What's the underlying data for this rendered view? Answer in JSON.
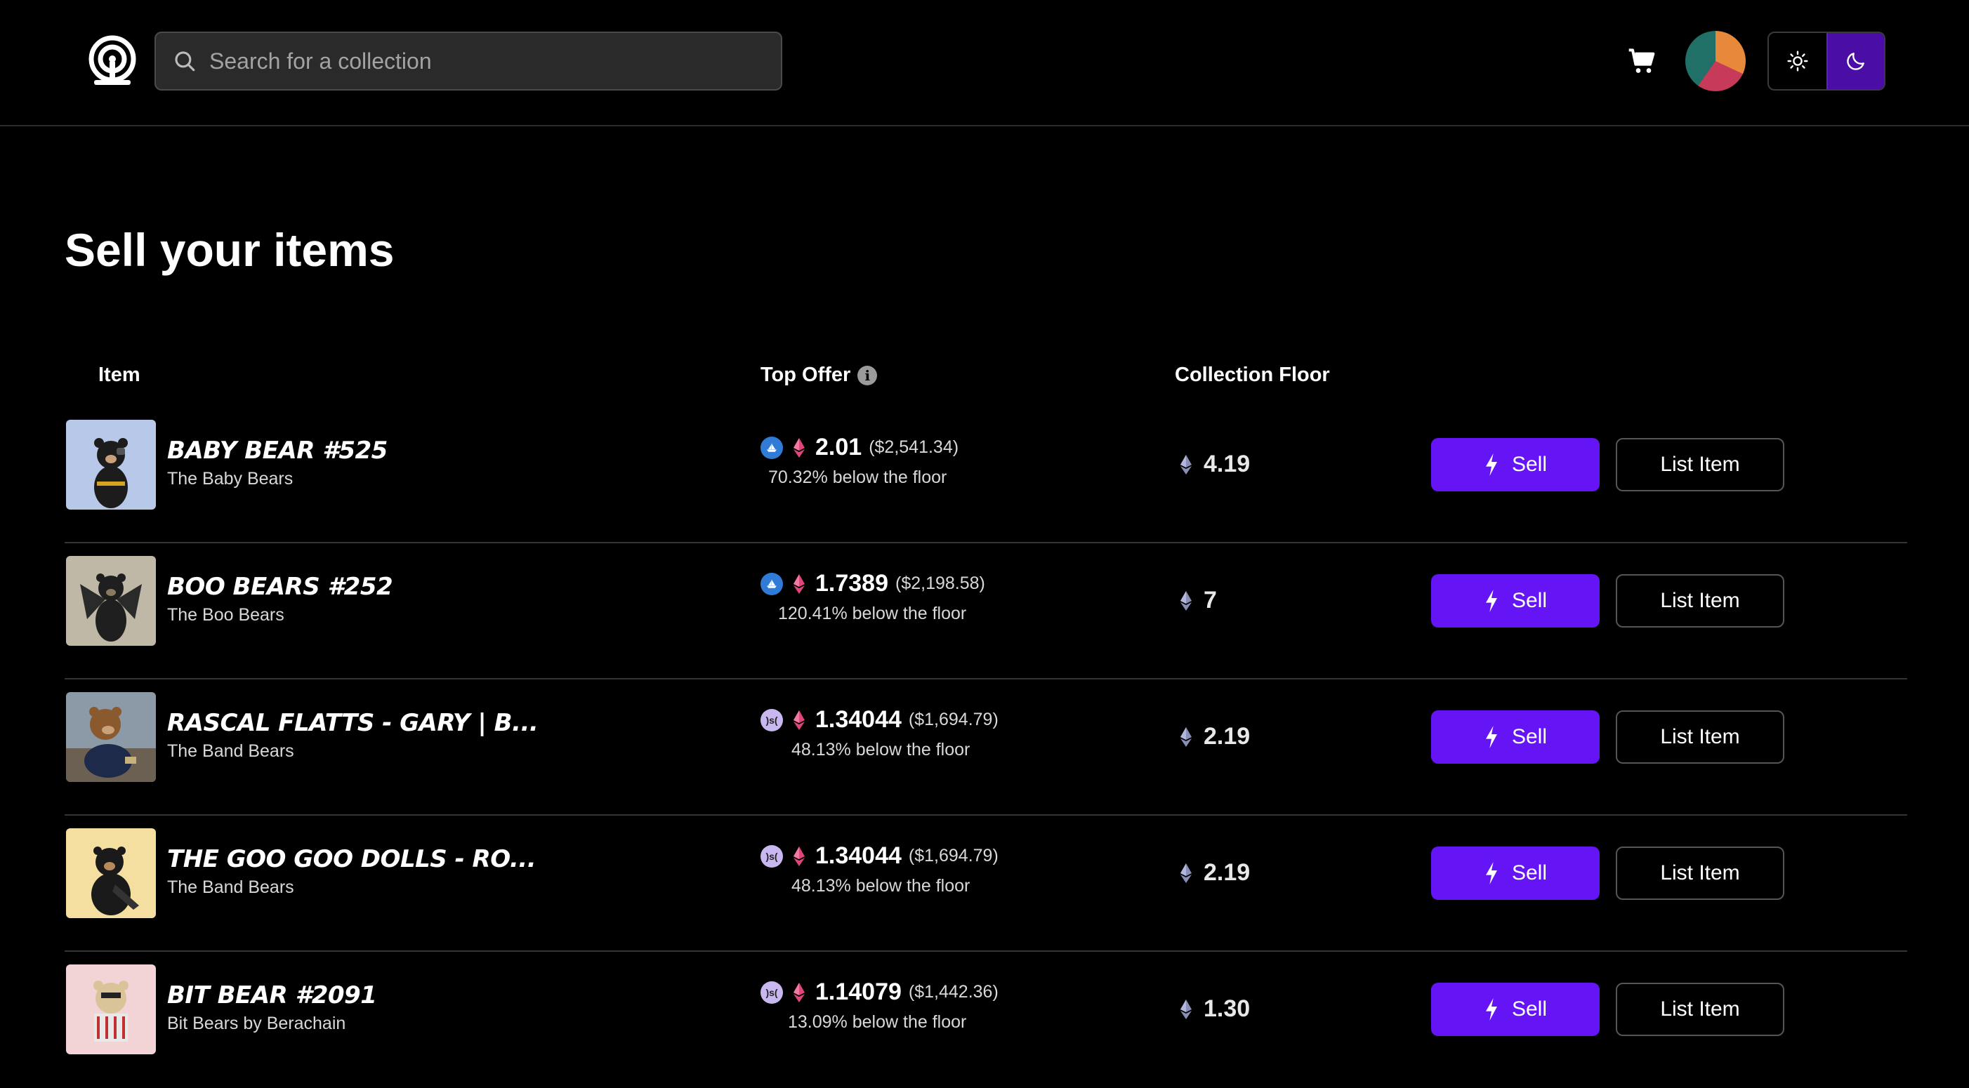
{
  "header": {
    "search_placeholder": "Search for a collection",
    "theme": "dark"
  },
  "page": {
    "title": "Sell your items"
  },
  "table": {
    "headers": {
      "item": "Item",
      "top_offer": "Top Offer",
      "collection_floor": "Collection Floor"
    },
    "rows": [
      {
        "name": "BABY BEAR #525",
        "collection": "The Baby Bears",
        "market_icon": "opensea-icon",
        "offer_price": "2.01",
        "offer_usd": "($2,541.34)",
        "below_floor": "70.32% below the floor",
        "floor": "4.19",
        "sell_label": "Sell",
        "list_label": "List Item",
        "thumb_bg": "#b7c8e8"
      },
      {
        "name": "BOO BEARS #252",
        "collection": "The Boo Bears",
        "market_icon": "opensea-icon",
        "offer_price": "1.7389",
        "offer_usd": "($2,198.58)",
        "below_floor": "120.41% below the floor",
        "floor": "7",
        "sell_label": "Sell",
        "list_label": "List Item",
        "thumb_bg": "#bfb8a6"
      },
      {
        "name": "RASCAL FLATTS - GARY | B...",
        "collection": "The Band Bears",
        "market_icon": "marketplace-icon",
        "market_text": ")s(",
        "offer_price": "1.34044",
        "offer_usd": "($1,694.79)",
        "below_floor": "48.13% below the floor",
        "floor": "2.19",
        "sell_label": "Sell",
        "list_label": "List Item",
        "thumb_bg": "#8c9aa8"
      },
      {
        "name": "THE GOO GOO DOLLS - RO...",
        "collection": "The Band Bears",
        "market_icon": "marketplace-icon",
        "market_text": ")s(",
        "offer_price": "1.34044",
        "offer_usd": "($1,694.79)",
        "below_floor": "48.13% below the floor",
        "floor": "2.19",
        "sell_label": "Sell",
        "list_label": "List Item",
        "thumb_bg": "#f4dfa0"
      },
      {
        "name": "BIT BEAR #2091",
        "collection": "Bit Bears by Berachain",
        "market_icon": "marketplace-icon",
        "market_text": ")s(",
        "offer_price": "1.14079",
        "offer_usd": "($1,442.36)",
        "below_floor": "13.09% below the floor",
        "floor": "1.30",
        "sell_label": "Sell",
        "list_label": "List Item",
        "thumb_bg": "#f2d3d6"
      }
    ]
  },
  "colors": {
    "accent": "#6414f5",
    "theme_active": "#4a0ea6",
    "background": "#000000"
  }
}
